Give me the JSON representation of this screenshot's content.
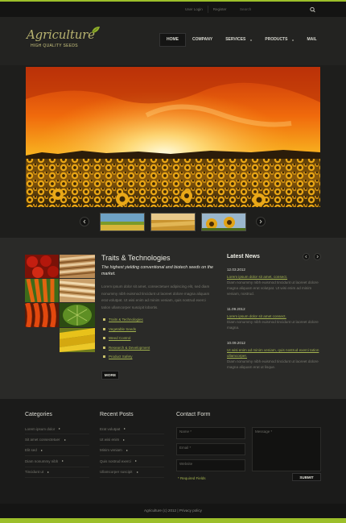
{
  "topbar": {
    "links": [
      "User Login",
      "Register"
    ],
    "search_placeholder": "Search",
    "search_icon": "search-icon"
  },
  "header": {
    "logo_title": "Agriculture",
    "logo_tagline": "HIGH QUALITY SEEDS",
    "logo_icon": "leaf-icon",
    "nav": [
      {
        "label": "HOME",
        "active": true
      },
      {
        "label": "COMPANY"
      },
      {
        "label": "SERVICES"
      },
      {
        "label": "PRODUCTS"
      },
      {
        "label": "MAIL"
      }
    ]
  },
  "slider": {
    "prev_icon": "chevron-left-icon",
    "next_icon": "chevron-right-icon"
  },
  "traits": {
    "title": "Traits & Technologies",
    "lead": "The highest yielding conventional and biotech seeds on the market.",
    "body": "Lorem ipsum dolor sit amet, consectetuer adipiscing elit, sed diam nonummy nibh euismod tincidunt ut laoreet dolore magna aliquam erat volutpat. Ut wisi enim ad minim veniam, quis nostrud exerci tation ullamcorper suscipit lobortis.",
    "items": [
      "Traits & Technologies",
      "Vegetable Seeds",
      "Weed Control",
      "Research & Development",
      "Product Safety"
    ],
    "more_label": "MORE"
  },
  "news": {
    "title": "Latest News",
    "items": [
      {
        "date": "12.03.2012",
        "link": "Lorem ipsum dolor sit amet, consect.",
        "text": "Diam nonummy nibh euismod tincidunt ut laoreet dolore magna aliquam erat volutpat. Ut wisi enim ad minim veniam, nostrud."
      },
      {
        "date": "11.09.2012",
        "link": "Lorem ipsum dolor sit amet consect.",
        "text": "Diam nonummy nibh euismod tincidunt ut laoreet dolore magna."
      },
      {
        "date": "10.09.2012",
        "link": "Ut wisi enim ad minim veniam, quis nostrud exerci tation ullamcorper.",
        "text": "Diam nonummy nibh euismod tincidunt ut laoreet dolore magna aliquam erat ut lisque."
      }
    ]
  },
  "footer": {
    "categories_title": "Categories",
    "categories": [
      "Lorem ipsum dolor",
      "Sit amet consectetuer",
      "Elit sed",
      "Diam nonummy nibh",
      "Tincidunt ut"
    ],
    "posts_title": "Recent Posts",
    "posts": [
      "Erat volutpat",
      "Ut wisi enim",
      "Minim veniam",
      "Quis nostrud exerci",
      "Ullamcorper suscipit"
    ],
    "contact_title": "Contact Form",
    "name_placeholder": "Name *",
    "email_placeholder": "Email *",
    "website_placeholder": "Website",
    "message_placeholder": "Message *",
    "required_note": "* Required Fields",
    "submit_label": "SUBMIT"
  },
  "copyright": "Agriculture (c) 2012  |  Privacy policy",
  "colors": {
    "accent": "#9cbf2a",
    "link": "#a3b34f"
  }
}
